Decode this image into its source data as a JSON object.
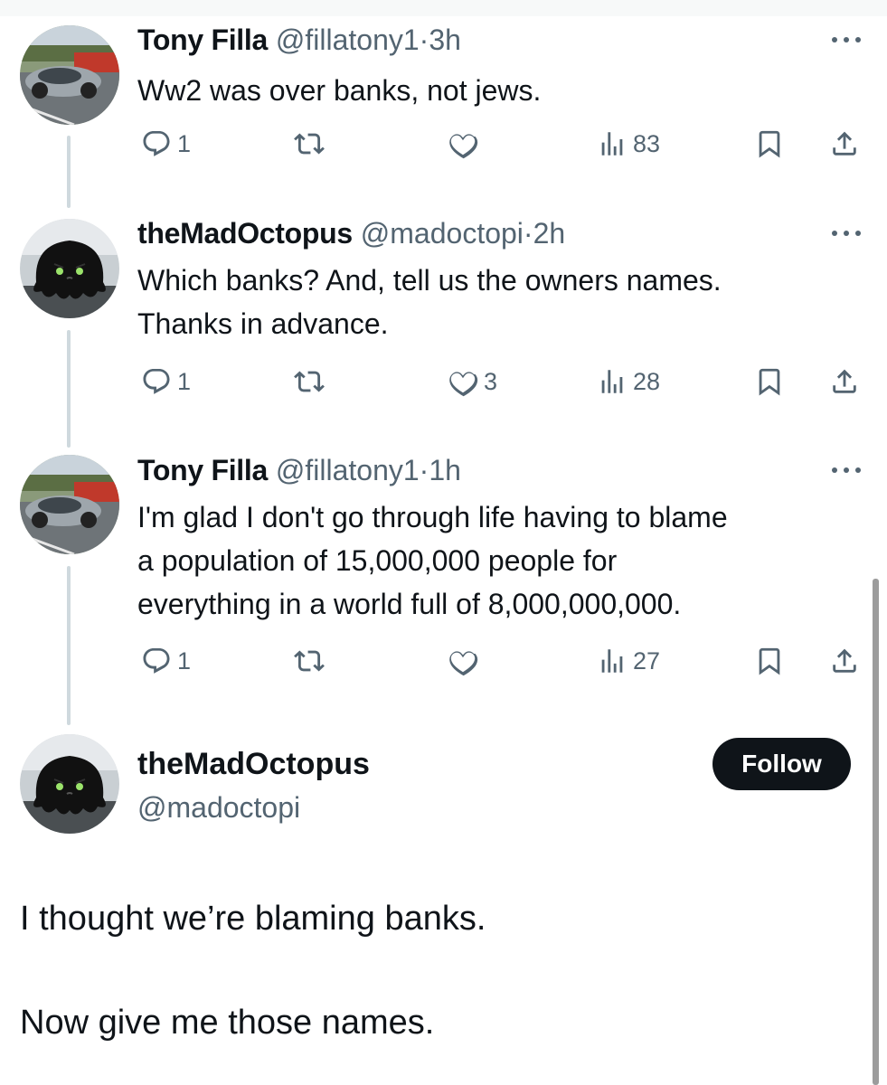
{
  "tweets": [
    {
      "name": "Tony Filla",
      "handle": "@fillatony1",
      "dot": "·",
      "time": "3h",
      "text": [
        "Ww2 was over banks, not jews."
      ],
      "replies": "1",
      "retweets": "",
      "likes": "",
      "views": "83",
      "avatar": "car-photo"
    },
    {
      "name": "theMadOctopus",
      "handle": "@madoctopi",
      "dot": "·",
      "time": "2h",
      "text": [
        "Which banks? And, tell us the owners names.",
        "Thanks in advance."
      ],
      "replies": "1",
      "retweets": "",
      "likes": "3",
      "views": "28",
      "avatar": "octopus-plush"
    },
    {
      "name": "Tony Filla",
      "handle": "@fillatony1",
      "dot": "·",
      "time": "1h",
      "text": [
        "I'm glad I don't go through life having to blame",
        "a population of 15,000,000 people for",
        "everything in a world full of 8,000,000,000."
      ],
      "replies": "1",
      "retweets": "",
      "likes": "",
      "views": "27",
      "avatar": "car-photo"
    }
  ],
  "main_tweet": {
    "name": "theMadOctopus",
    "handle": "@madoctopi",
    "follow_label": "Follow",
    "text": [
      "I thought we’re blaming banks.",
      "Now give me those names."
    ],
    "avatar": "octopus-plush"
  },
  "icons": {
    "reply": "reply-icon",
    "retweet": "retweet-icon",
    "like": "heart-icon",
    "views": "views-icon",
    "bookmark": "bookmark-icon",
    "share": "share-icon",
    "more": "more-icon"
  },
  "colors": {
    "text": "#0f1419",
    "secondary": "#536471",
    "thread_line": "#cfd9de",
    "follow_bg": "#0f1419"
  }
}
